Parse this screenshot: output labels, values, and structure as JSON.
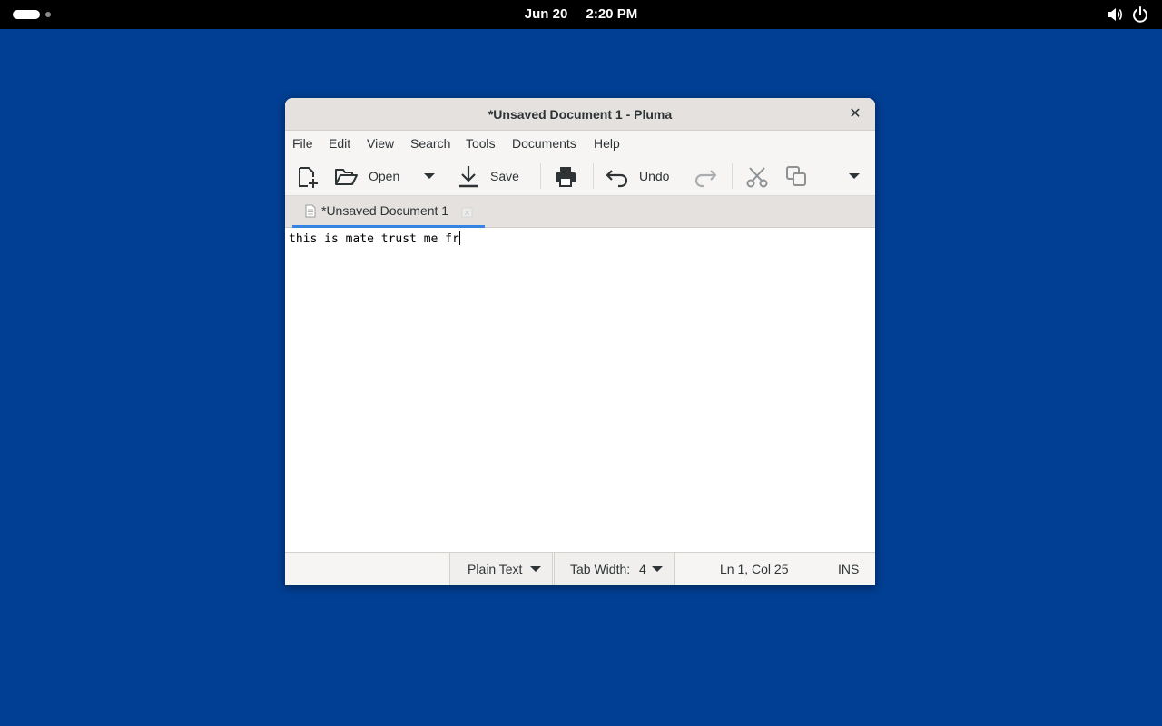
{
  "topbar": {
    "date": "Jun 20",
    "time": "2:20 PM",
    "icons": [
      "activities-indicator",
      "volume-icon",
      "power-icon"
    ]
  },
  "window": {
    "title": "*Unsaved Document 1 - Pluma",
    "close_glyph": "✕",
    "menu": [
      "File",
      "Edit",
      "View",
      "Search",
      "Tools",
      "Documents",
      "Help"
    ],
    "toolbar": {
      "new_icon": "new-document-icon",
      "open_label": "Open",
      "open_dropdown_icon": "dropdown-arrow-icon",
      "save_label": "Save",
      "print_icon": "print-icon",
      "undo_label": "Undo",
      "redo_icon": "redo-icon",
      "cut_icon": "cut-icon",
      "copy_icon": "copy-icon",
      "overflow_icon": "overflow-arrow-icon"
    },
    "tab": {
      "label": "*Unsaved Document 1",
      "accent": "#3584e4"
    },
    "editor": {
      "content": "this is mate trust me fr"
    },
    "statusbar": {
      "language": "Plain Text",
      "tab_width_label": "Tab Width:",
      "tab_width_value": "4",
      "position": "Ln 1, Col 25",
      "mode": "INS"
    }
  },
  "colors": {
    "desktop": "#003f94",
    "topbar": "#000000",
    "titlebar": "#e4e1de"
  }
}
